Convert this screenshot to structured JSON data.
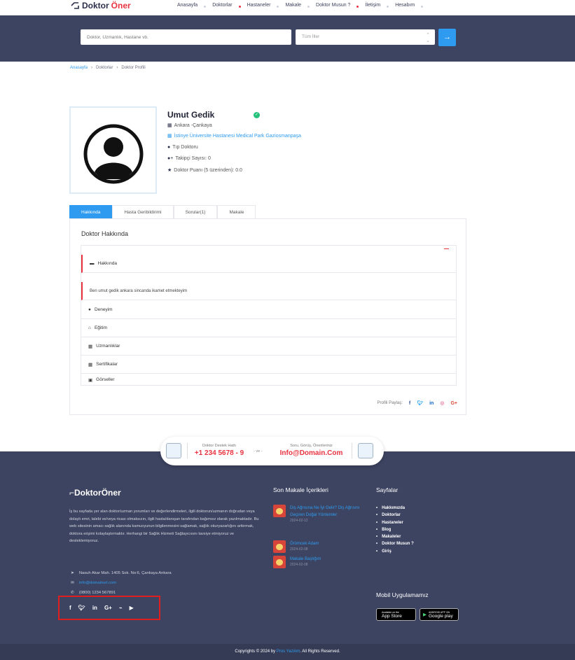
{
  "header": {
    "logo": {
      "prefix": "Doktor",
      "accent": "Öner"
    },
    "nav": [
      "Anasayfa",
      "Doktorlar",
      "Hastaneler",
      "Makale",
      "Doktor Musun ?",
      "İletişim",
      "Hesabım"
    ]
  },
  "search": {
    "placeholder": "Doktor, Uzmanlık, Hastane vb.",
    "city_selected": "Tüm İller",
    "button_icon": "arrow-right-icon"
  },
  "breadcrumb": [
    "Anasayfa",
    "Doktorlar",
    "Doktor Profili"
  ],
  "profile": {
    "name": "Umut Gedik",
    "location": "Ankara -Çankaya",
    "hospital": "İstinye Üniversite Hastanesi Medical Park Gaziosmanpaşa",
    "title": "Tıp Doktoru",
    "followers": "Takipçi Sayısı: 0",
    "rating": "Doktor Puanı (5 üzerinden): 0.0"
  },
  "tabs": [
    "Hakkında",
    "Hasta Geribildirimi",
    "Sorular(1)",
    "Makale"
  ],
  "about": {
    "title": "Doktor Hakkında",
    "sections": [
      "Hakkında",
      "Deneyim",
      "Eğitim",
      "Uzmanlıklar",
      "Sertifikalar",
      "Görseller"
    ],
    "about_text": "Ben umut gedik ankara sincanda ikamet etmekteyim",
    "share_label": "Profili Paylaş:"
  },
  "support": {
    "hotline_label": "Doktor Destek Hattı",
    "hotline": "+1 234 5678 - 9",
    "separator": "- ve -",
    "mail_label": "Soru, Görüş, Önerileriniz",
    "mail": "Info@Domain.Com"
  },
  "footer": {
    "logo": {
      "prefix": "Doktor",
      "accent": "Öner"
    },
    "description": "İş bu sayfada yer alan doktor/uzman yorumları ve değerlendirmeleri, ilgili doktorun/uzmanın doğrudan veya dolaylı emri, talebi ve/veya ricası olmaksızın, ilgili hasta/danışan tarafından bağımsız olarak yazılmaktadır. Bu web sitesinin amacı sağlık alanında kamuoyunun bilgilenmesini sağlamak, sağlık okuryazarlığını arttırmak, doktora erişimi kolaylaştırmaktır. Herhangi bir Sağlık Hizmeti Sağlayıcısını tavsiye etmiyoruz ve desteklemiyoruz.",
    "address": "Nasuh Akar Mah. 1405 Sok. No:6, Çankaya Ankara",
    "email": "info@domainurl.com",
    "phone": "(0800) 1234 567891",
    "articles_title": "Son Makale İçerikleri",
    "articles": [
      {
        "title": "Diş Ağrısına Ne İyi Gelir? Diş Ağrısını Geçiren Doğal Yöntemler",
        "date": "2024-02-12"
      },
      {
        "title": "Örümcek Adam",
        "date": "2024-02-08"
      },
      {
        "title": "Makale Başlığım",
        "date": "2024-02-08"
      }
    ],
    "pages_title": "Sayfalar",
    "pages": [
      "Hakkımızda",
      "Doktorlar",
      "Hastaneler",
      "Blog",
      "Makaleler",
      "Doktor Musun ?",
      "Giriş"
    ],
    "app_title": "Mobil Uygulamamız",
    "app_store": {
      "small": "Available on the",
      "big": "App Store"
    },
    "google_play": {
      "small": "ANDROID APP ON",
      "big": "Google play"
    },
    "copyright": {
      "before": "Copyrights © 2024 by ",
      "brand": "Pros Yazılım",
      "after": ". All Rights Reserved."
    }
  },
  "colors": {
    "navy": "#3d4461",
    "accent_red": "#e8323f",
    "accent_blue": "#2e9bf0",
    "verified_green": "#26c17a"
  }
}
